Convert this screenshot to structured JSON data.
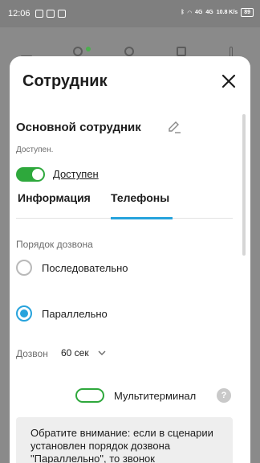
{
  "status_bar": {
    "time": "12:06",
    "network_left": "4G",
    "network_right": "4G",
    "speed": "10.8 K/s",
    "battery": "89"
  },
  "sheet": {
    "title": "Сотрудник",
    "employee_name": "Основной сотрудник",
    "availability_caption": "Доступен.",
    "availability_toggle_label": "Доступен",
    "tabs": [
      {
        "label": "Информация",
        "active": false
      },
      {
        "label": "Телефоны",
        "active": true
      }
    ],
    "dial_order_label": "Порядок дозвона",
    "options": [
      {
        "label": "Последовательно",
        "selected": false
      },
      {
        "label": "Параллельно",
        "selected": true
      }
    ],
    "dial_label": "Дозвон",
    "dial_value": "60 сек",
    "multiterminal_label": "Мультитерминал",
    "help_symbol": "?",
    "note_text": "Обратите внимание: если в сценарии установлен порядок дозвона \"Параллельно\", то звонок"
  },
  "colors": {
    "accent": "#27a3dc",
    "toggle_green": "#2ea83c"
  }
}
